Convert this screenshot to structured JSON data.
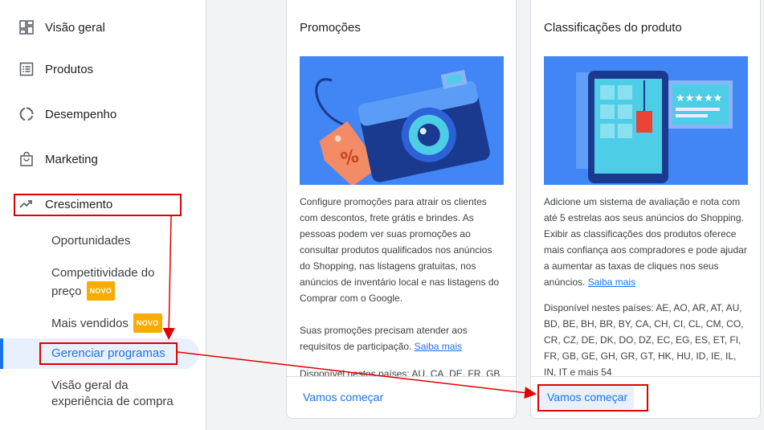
{
  "sidebar": {
    "items": [
      {
        "label": "Visão geral",
        "icon": "dashboard-icon"
      },
      {
        "label": "Produtos",
        "icon": "list-icon"
      },
      {
        "label": "Desempenho",
        "icon": "donut-chart-icon"
      },
      {
        "label": "Marketing",
        "icon": "shopping-bag-icon"
      },
      {
        "label": "Crescimento",
        "icon": "trending-up-icon"
      }
    ],
    "sub_items": [
      {
        "label": "Oportunidades"
      },
      {
        "label_line1": "Competitividade do",
        "label_line2": "preço",
        "badge": "NOVO"
      },
      {
        "label": "Mais vendidos",
        "badge": "NOVO"
      },
      {
        "label": "Gerenciar programas",
        "active": true
      },
      {
        "label_line1": "Visão geral da",
        "label_line2": "experiência de compra"
      }
    ]
  },
  "cards": [
    {
      "title": "Promoções",
      "illustration": "camera-with-discount-tag",
      "description": "Configure promoções para atrair os clientes com descontos, frete grátis e brindes. As pessoas podem ver suas promoções ao consultar produtos qualificados nos anúncios do Shopping, nas listagens gratuitas, nos anúncios de inventário local e nas listagens do Comprar com o Google.",
      "requirements": "Suas promoções precisam atender aos requisitos de participação.",
      "link": "Saiba mais",
      "countries": "Disponível nestes países: AU, CA, DE, FR, GB, IN, US",
      "cta": "Vamos começar"
    },
    {
      "title": "Classificações do produto",
      "illustration": "tablet-with-star-rating",
      "description": "Adicione um sistema de avaliação e nota com até 5 estrelas aos seus anúncios do Shopping. Exibir as classificações dos produtos oferece mais confiança aos compradores e pode ajudar a aumentar as taxas de cliques nos seus anúncios.",
      "link": "Saiba mais",
      "countries": "Disponível nestes países: AE, AO, AR, AT, AU, BD, BE, BH, BR, BY, CA, CH, CI, CL, CM, CO, CR, CZ, DE, DK, DO, DZ, EC, EG, ES, ET, FI, FR, GB, GE, GH, GR, GT, HK, HU, ID, IE, IL, IN, IT",
      "more": "e mais 54",
      "cta": "Vamos começar"
    }
  ],
  "colors": {
    "accent": "#1a73e8",
    "badge": "#f9ab00",
    "annotation": "#e00000",
    "illustration_bg": "#4285f4"
  }
}
